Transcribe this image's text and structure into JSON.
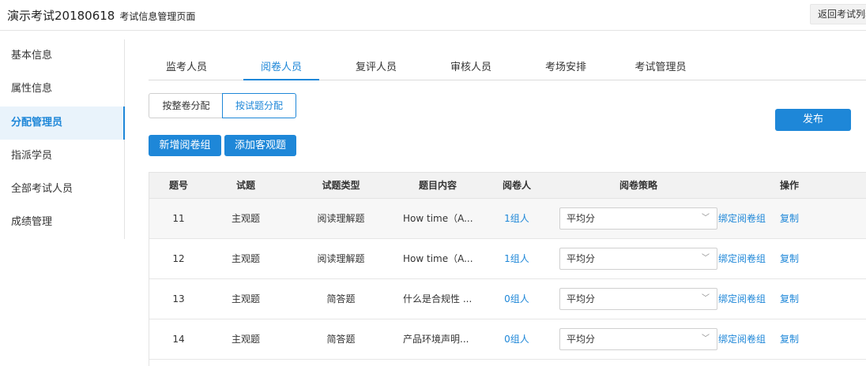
{
  "header": {
    "exam_name": "演示考试20180618",
    "page_label": "考试信息管理页面",
    "back_label": "返回考试列表"
  },
  "sidebar": {
    "items": [
      {
        "label": "基本信息"
      },
      {
        "label": "属性信息"
      },
      {
        "label": "分配管理员"
      },
      {
        "label": "指派学员"
      },
      {
        "label": "全部考试人员"
      },
      {
        "label": "成绩管理"
      }
    ],
    "active_index": 2
  },
  "tabs": [
    {
      "label": "监考人员"
    },
    {
      "label": "阅卷人员"
    },
    {
      "label": "复评人员"
    },
    {
      "label": "审核人员"
    },
    {
      "label": "考场安排"
    },
    {
      "label": "考试管理员"
    }
  ],
  "active_tab_index": 1,
  "segment": {
    "left_label": "按整卷分配",
    "right_label": "按试题分配",
    "selected": "right"
  },
  "actions": {
    "new_group_label": "新增阅卷组",
    "add_objective_label": "添加客观题",
    "publish_label": "发布"
  },
  "table": {
    "headers": [
      "题号",
      "试题",
      "试题类型",
      "题目内容",
      "阅卷人",
      "阅卷策略",
      "操作"
    ],
    "rows": [
      {
        "no": "11",
        "question": "主观题",
        "type": "阅读理解题",
        "content": "How time（A...",
        "markers": "1组人",
        "strategy": "平均分",
        "bind_label": "绑定阅卷组",
        "copy_label": "复制"
      },
      {
        "no": "12",
        "question": "主观题",
        "type": "阅读理解题",
        "content": "How time（A...",
        "markers": "1组人",
        "strategy": "平均分",
        "bind_label": "绑定阅卷组",
        "copy_label": "复制"
      },
      {
        "no": "13",
        "question": "主观题",
        "type": "简答题",
        "content": "什么是合规性 ...",
        "markers": "0组人",
        "strategy": "平均分",
        "bind_label": "绑定阅卷组",
        "copy_label": "复制"
      },
      {
        "no": "14",
        "question": "主观题",
        "type": "简答题",
        "content": "产品环境声明...",
        "markers": "0组人",
        "strategy": "平均分",
        "bind_label": "绑定阅卷组",
        "copy_label": "复制"
      }
    ]
  }
}
